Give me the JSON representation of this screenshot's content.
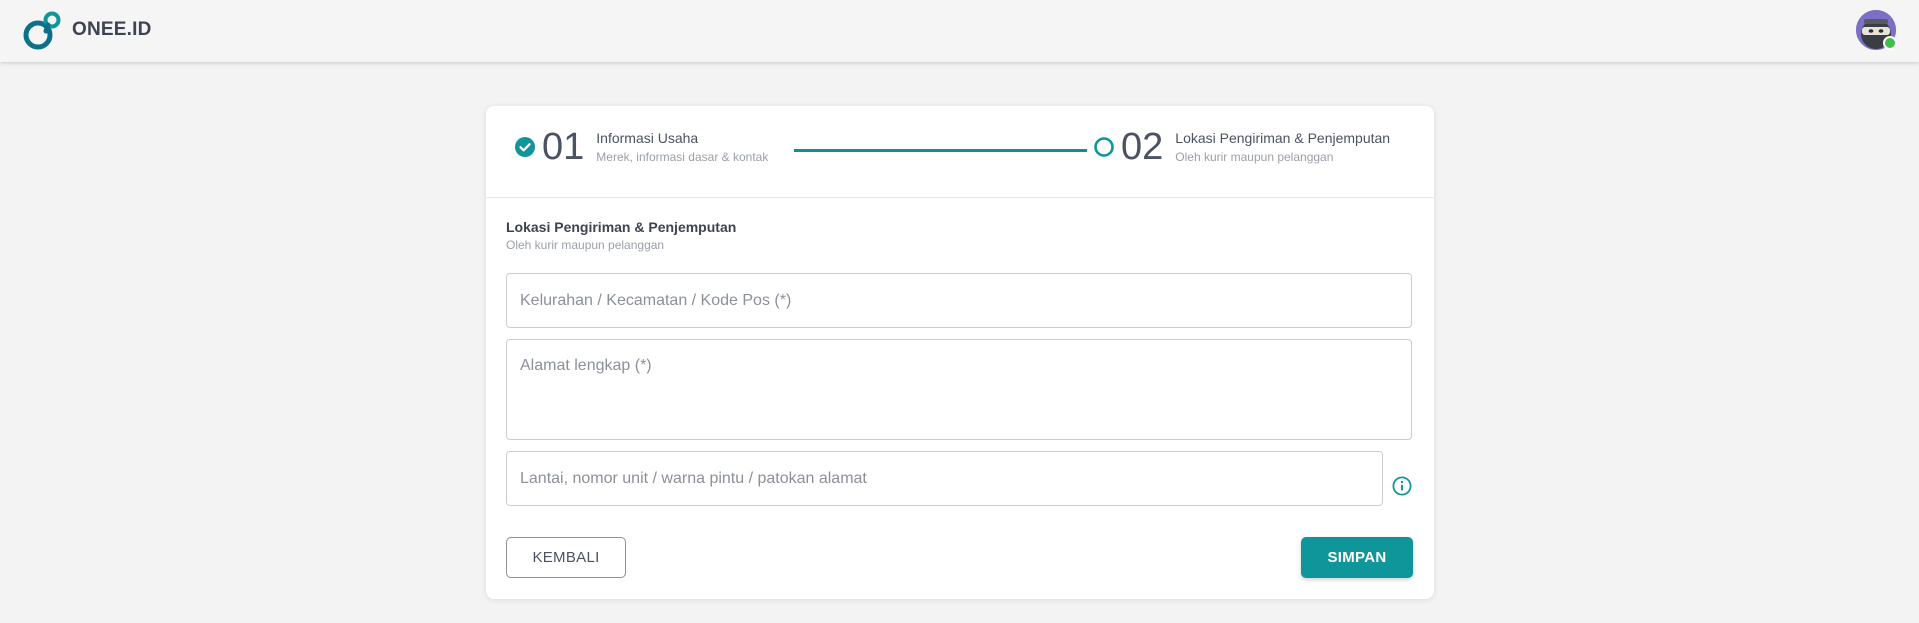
{
  "header": {
    "brand": "ONEE.ID",
    "logo_icon": "infinity-link-logo",
    "avatar_icon": "ninja-avatar",
    "status": "online",
    "colors": {
      "brand": "#0e6f8a",
      "accent": "#0e969b"
    }
  },
  "stepper": {
    "steps": [
      {
        "number": "01",
        "title": "Informasi Usaha",
        "subtitle": "Merek, informasi dasar & kontak",
        "state": "completed",
        "icon": "check-circle-icon"
      },
      {
        "number": "02",
        "title": "Lokasi Pengiriman & Penjemputan",
        "subtitle": "Oleh kurir maupun pelanggan",
        "state": "current",
        "icon": "circle-outline-icon"
      }
    ]
  },
  "form": {
    "title": "Lokasi Pengiriman & Penjemputan",
    "subtitle": "Oleh kurir maupun pelanggan",
    "fields": {
      "area": {
        "placeholder": "Kelurahan / Kecamatan / Kode Pos (*)",
        "value": ""
      },
      "address": {
        "placeholder": "Alamat lengkap (*)",
        "value": ""
      },
      "detail": {
        "placeholder": "Lantai, nomor unit / warna pintu / patokan alamat",
        "value": ""
      }
    },
    "info_icon": "info-circle-icon",
    "buttons": {
      "back": "KEMBALI",
      "save": "SIMPAN"
    }
  }
}
